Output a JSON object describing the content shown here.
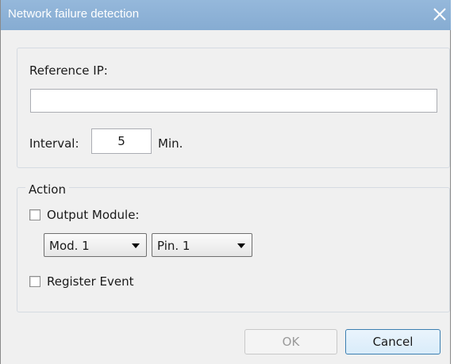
{
  "window": {
    "title": "Network failure detection",
    "close_glyph": "close-icon"
  },
  "reference": {
    "label": "Reference IP:",
    "ip_value": "",
    "interval_label": "Interval:",
    "interval_value": "5",
    "interval_unit": "Min."
  },
  "action": {
    "legend": "Action",
    "output_module": {
      "label": "Output Module:",
      "checked": false
    },
    "module_select": {
      "selected": "Mod. 1"
    },
    "pin_select": {
      "selected": "Pin. 1"
    },
    "register_event": {
      "label": "Register Event",
      "checked": false
    }
  },
  "buttons": {
    "ok_label": "OK",
    "ok_enabled": false,
    "cancel_label": "Cancel"
  },
  "colors": {
    "titlebar": "#8fb3d6",
    "dialog_bg": "#f0f0f0",
    "default_button_border": "#3c7fb1"
  }
}
